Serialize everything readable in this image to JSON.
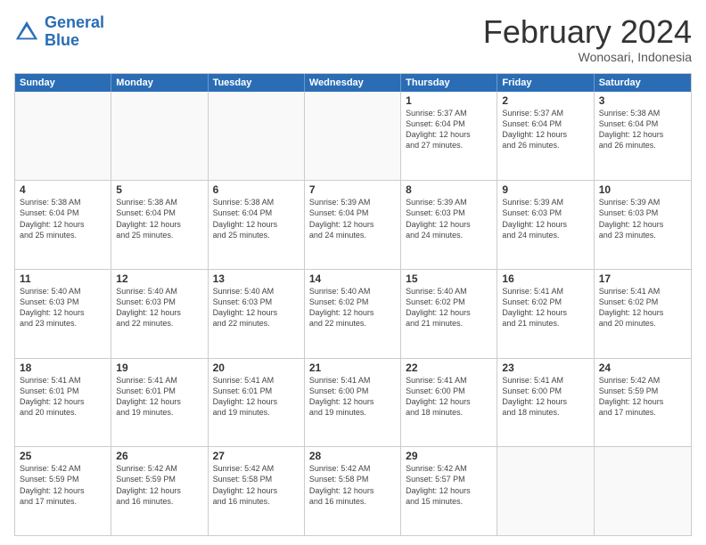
{
  "header": {
    "logo_line1": "General",
    "logo_line2": "Blue",
    "month": "February 2024",
    "location": "Wonosari, Indonesia"
  },
  "days_of_week": [
    "Sunday",
    "Monday",
    "Tuesday",
    "Wednesday",
    "Thursday",
    "Friday",
    "Saturday"
  ],
  "weeks": [
    [
      {
        "day": "",
        "info": ""
      },
      {
        "day": "",
        "info": ""
      },
      {
        "day": "",
        "info": ""
      },
      {
        "day": "",
        "info": ""
      },
      {
        "day": "1",
        "info": "Sunrise: 5:37 AM\nSunset: 6:04 PM\nDaylight: 12 hours\nand 27 minutes."
      },
      {
        "day": "2",
        "info": "Sunrise: 5:37 AM\nSunset: 6:04 PM\nDaylight: 12 hours\nand 26 minutes."
      },
      {
        "day": "3",
        "info": "Sunrise: 5:38 AM\nSunset: 6:04 PM\nDaylight: 12 hours\nand 26 minutes."
      }
    ],
    [
      {
        "day": "4",
        "info": "Sunrise: 5:38 AM\nSunset: 6:04 PM\nDaylight: 12 hours\nand 25 minutes."
      },
      {
        "day": "5",
        "info": "Sunrise: 5:38 AM\nSunset: 6:04 PM\nDaylight: 12 hours\nand 25 minutes."
      },
      {
        "day": "6",
        "info": "Sunrise: 5:38 AM\nSunset: 6:04 PM\nDaylight: 12 hours\nand 25 minutes."
      },
      {
        "day": "7",
        "info": "Sunrise: 5:39 AM\nSunset: 6:04 PM\nDaylight: 12 hours\nand 24 minutes."
      },
      {
        "day": "8",
        "info": "Sunrise: 5:39 AM\nSunset: 6:03 PM\nDaylight: 12 hours\nand 24 minutes."
      },
      {
        "day": "9",
        "info": "Sunrise: 5:39 AM\nSunset: 6:03 PM\nDaylight: 12 hours\nand 24 minutes."
      },
      {
        "day": "10",
        "info": "Sunrise: 5:39 AM\nSunset: 6:03 PM\nDaylight: 12 hours\nand 23 minutes."
      }
    ],
    [
      {
        "day": "11",
        "info": "Sunrise: 5:40 AM\nSunset: 6:03 PM\nDaylight: 12 hours\nand 23 minutes."
      },
      {
        "day": "12",
        "info": "Sunrise: 5:40 AM\nSunset: 6:03 PM\nDaylight: 12 hours\nand 22 minutes."
      },
      {
        "day": "13",
        "info": "Sunrise: 5:40 AM\nSunset: 6:03 PM\nDaylight: 12 hours\nand 22 minutes."
      },
      {
        "day": "14",
        "info": "Sunrise: 5:40 AM\nSunset: 6:02 PM\nDaylight: 12 hours\nand 22 minutes."
      },
      {
        "day": "15",
        "info": "Sunrise: 5:40 AM\nSunset: 6:02 PM\nDaylight: 12 hours\nand 21 minutes."
      },
      {
        "day": "16",
        "info": "Sunrise: 5:41 AM\nSunset: 6:02 PM\nDaylight: 12 hours\nand 21 minutes."
      },
      {
        "day": "17",
        "info": "Sunrise: 5:41 AM\nSunset: 6:02 PM\nDaylight: 12 hours\nand 20 minutes."
      }
    ],
    [
      {
        "day": "18",
        "info": "Sunrise: 5:41 AM\nSunset: 6:01 PM\nDaylight: 12 hours\nand 20 minutes."
      },
      {
        "day": "19",
        "info": "Sunrise: 5:41 AM\nSunset: 6:01 PM\nDaylight: 12 hours\nand 19 minutes."
      },
      {
        "day": "20",
        "info": "Sunrise: 5:41 AM\nSunset: 6:01 PM\nDaylight: 12 hours\nand 19 minutes."
      },
      {
        "day": "21",
        "info": "Sunrise: 5:41 AM\nSunset: 6:00 PM\nDaylight: 12 hours\nand 19 minutes."
      },
      {
        "day": "22",
        "info": "Sunrise: 5:41 AM\nSunset: 6:00 PM\nDaylight: 12 hours\nand 18 minutes."
      },
      {
        "day": "23",
        "info": "Sunrise: 5:41 AM\nSunset: 6:00 PM\nDaylight: 12 hours\nand 18 minutes."
      },
      {
        "day": "24",
        "info": "Sunrise: 5:42 AM\nSunset: 5:59 PM\nDaylight: 12 hours\nand 17 minutes."
      }
    ],
    [
      {
        "day": "25",
        "info": "Sunrise: 5:42 AM\nSunset: 5:59 PM\nDaylight: 12 hours\nand 17 minutes."
      },
      {
        "day": "26",
        "info": "Sunrise: 5:42 AM\nSunset: 5:59 PM\nDaylight: 12 hours\nand 16 minutes."
      },
      {
        "day": "27",
        "info": "Sunrise: 5:42 AM\nSunset: 5:58 PM\nDaylight: 12 hours\nand 16 minutes."
      },
      {
        "day": "28",
        "info": "Sunrise: 5:42 AM\nSunset: 5:58 PM\nDaylight: 12 hours\nand 16 minutes."
      },
      {
        "day": "29",
        "info": "Sunrise: 5:42 AM\nSunset: 5:57 PM\nDaylight: 12 hours\nand 15 minutes."
      },
      {
        "day": "",
        "info": ""
      },
      {
        "day": "",
        "info": ""
      }
    ]
  ]
}
